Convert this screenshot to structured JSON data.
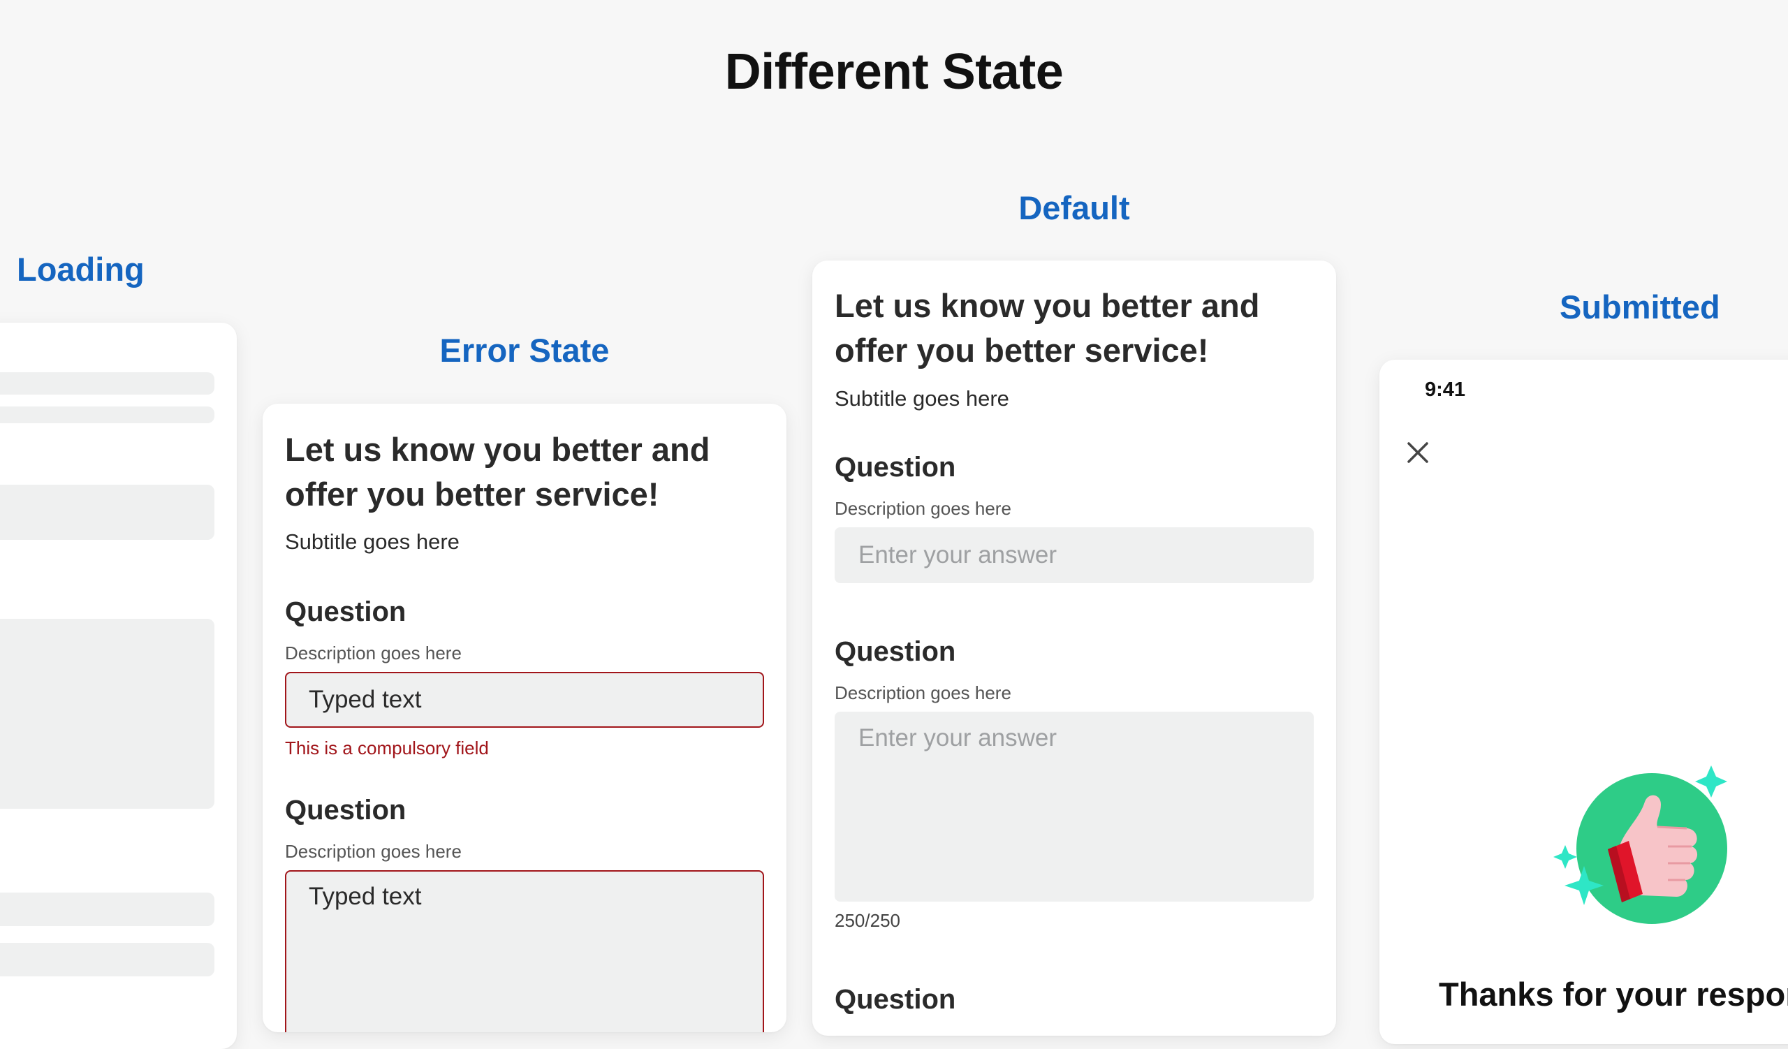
{
  "page": {
    "title": "Different State"
  },
  "states": {
    "loading_label": "Loading",
    "error_label": "Error State",
    "default_label": "Default",
    "submitted_label": "Submitted"
  },
  "error_form": {
    "title": "Let us know you better and offer you better service!",
    "subtitle": "Subtitle goes here",
    "q1": {
      "title": "Question",
      "description": "Description goes here",
      "value": "Typed text",
      "error": "This is a compulsory field"
    },
    "q2": {
      "title": "Question",
      "description": "Description goes here",
      "value": "Typed text"
    }
  },
  "default_form": {
    "title": "Let us know you better and offer you better service!",
    "subtitle": "Subtitle goes here",
    "q1": {
      "title": "Question",
      "description": "Description goes here",
      "placeholder": "Enter your answer"
    },
    "q2": {
      "title": "Question",
      "description": "Description goes here",
      "placeholder": "Enter your answer",
      "counter": "250/250"
    },
    "q3": {
      "title": "Question"
    }
  },
  "submitted": {
    "time": "9:41",
    "close_icon": "close-icon",
    "illustration_icon": "thumbs-up-icon",
    "thanks": "Thanks for your response"
  },
  "colors": {
    "label_blue": "#1565c0",
    "error_red": "#a1151a",
    "field_gray": "#eff0f0",
    "illustration_green": "#2ecc87",
    "sparkle_teal": "#2ee6c6",
    "cuff_red": "#e0152a",
    "hand_pink": "#f7c4c8"
  }
}
